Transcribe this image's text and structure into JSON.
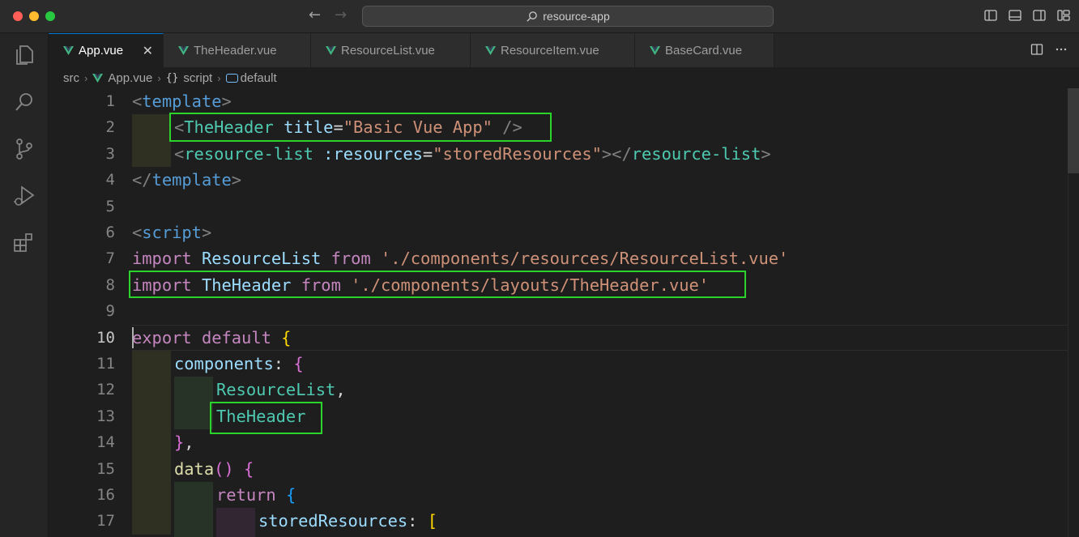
{
  "window": {
    "command_center": "resource-app"
  },
  "tabs": [
    {
      "label": "App.vue",
      "active": true
    },
    {
      "label": "TheHeader.vue",
      "active": false
    },
    {
      "label": "ResourceList.vue",
      "active": false
    },
    {
      "label": "ResourceItem.vue",
      "active": false
    },
    {
      "label": "BaseCard.vue",
      "active": false
    }
  ],
  "tab_close": "✕",
  "breadcrumb": {
    "folder": "src",
    "file": "App.vue",
    "section_sym": "{}",
    "section": "script",
    "symbol": "default"
  },
  "editor": {
    "current_line": 10,
    "line_numbers": [
      "1",
      "2",
      "3",
      "4",
      "5",
      "6",
      "7",
      "8",
      "9",
      "10",
      "11",
      "12",
      "13",
      "14",
      "15",
      "16",
      "17"
    ],
    "tokens": {
      "l1": [
        "<",
        "template",
        ">"
      ],
      "l2": [
        "<",
        "TheHeader",
        " ",
        "title",
        "=",
        "\"Basic Vue App\"",
        " />"
      ],
      "l3": [
        "<",
        "resource-list",
        " ",
        ":resources",
        "=",
        "\"storedResources\"",
        "></",
        "resource-list",
        ">"
      ],
      "l4": [
        "</",
        "template",
        ">"
      ],
      "l6": [
        "<",
        "script",
        ">"
      ],
      "l7": [
        "import",
        " ",
        "ResourceList",
        " ",
        "from",
        " ",
        "'./components/resources/ResourceList.vue'"
      ],
      "l8": [
        "import",
        " ",
        "TheHeader",
        " ",
        "from",
        " ",
        "'./components/layouts/TheHeader.vue'"
      ],
      "l10": [
        "export",
        " ",
        "default",
        " ",
        "{"
      ],
      "l11": [
        "components",
        ": ",
        "{"
      ],
      "l12": [
        "ResourceList",
        ","
      ],
      "l13": [
        "TheHeader"
      ],
      "l14": [
        "}",
        ","
      ],
      "l15": [
        "data",
        "()",
        " ",
        "{"
      ],
      "l16": [
        "return",
        " ",
        "{"
      ],
      "l17": [
        "storedResources",
        ": ",
        "["
      ]
    }
  },
  "colors": {
    "highlight_box": "#2bd42b",
    "accent": "#0078d4",
    "vue_green": "#41b883"
  },
  "icons": {
    "activity": [
      "files-icon",
      "search-icon",
      "source-control-icon",
      "run-debug-icon",
      "extensions-icon"
    ],
    "layout": [
      "toggle-primary-sidebar-icon",
      "toggle-panel-icon",
      "toggle-secondary-sidebar-icon",
      "customize-layout-icon"
    ],
    "editor_actions": [
      "split-editor-icon",
      "more-actions-icon"
    ]
  }
}
